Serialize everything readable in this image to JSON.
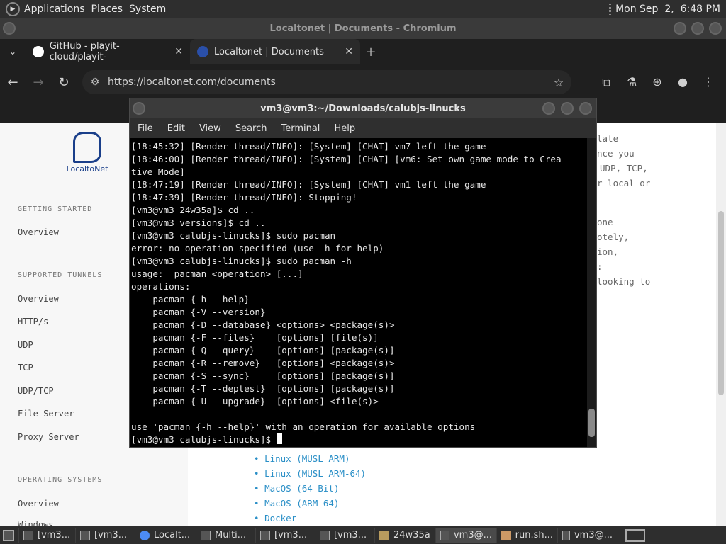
{
  "top_panel": {
    "menus": [
      "Applications",
      "Places",
      "System"
    ],
    "clock": "Mon Sep  2,  6:48 PM"
  },
  "browser": {
    "window_title": "Localtonet | Documents - Chromium",
    "tabs": [
      {
        "label": "GitHub - playit-cloud/playit-",
        "icon": "github-icon"
      },
      {
        "label": "Localtonet | Documents",
        "icon": "localtonet-icon"
      }
    ],
    "url": "https://localtonet.com/documents",
    "page": {
      "logo_text": "LocaltoNet",
      "sidebar": {
        "sections": [
          {
            "title": "GETTING STARTED",
            "items": [
              "Overview"
            ]
          },
          {
            "title": "SUPPORTED TUNNELS",
            "items": [
              "Overview",
              "HTTP/s",
              "UDP",
              "TCP",
              "UDP/TCP",
              "File Server",
              "Proxy Server"
            ]
          },
          {
            "title": "OPERATING SYSTEMS",
            "items": [
              "Overview",
              "Windows"
            ]
          }
        ]
      },
      "right_fragments": [
        "late",
        "nce you",
        "UDP, TCP,",
        "r local or",
        "one",
        "otely,",
        "ion,",
        ":",
        "looking to"
      ],
      "downloads": [
        "Linux (MUSL ARM)",
        "Linux (MUSL ARM-64)",
        "MacOS (64-Bit)",
        "MacOS (ARM-64)",
        "Docker"
      ]
    }
  },
  "terminal": {
    "title": "vm3@vm3:~/Downloads/calubjs-linucks",
    "menu": [
      "File",
      "Edit",
      "View",
      "Search",
      "Terminal",
      "Help"
    ],
    "lines": [
      "[18:45:32] [Render thread/INFO]: [System] [CHAT] vm7 left the game",
      "[18:46:00] [Render thread/INFO]: [System] [CHAT] [vm6: Set own game mode to Crea",
      "tive Mode]",
      "[18:47:19] [Render thread/INFO]: [System] [CHAT] vm1 left the game",
      "[18:47:39] [Render thread/INFO]: Stopping!",
      "[vm3@vm3 24w35a]$ cd ..",
      "[vm3@vm3 versions]$ cd ..",
      "[vm3@vm3 calubjs-linucks]$ sudo pacman",
      "error: no operation specified (use -h for help)",
      "[vm3@vm3 calubjs-linucks]$ sudo pacman -h",
      "usage:  pacman <operation> [...]",
      "operations:",
      "    pacman {-h --help}",
      "    pacman {-V --version}",
      "    pacman {-D --database} <options> <package(s)>",
      "    pacman {-F --files}    [options] [file(s)]",
      "    pacman {-Q --query}    [options] [package(s)]",
      "    pacman {-R --remove}   [options] <package(s)>",
      "    pacman {-S --sync}     [options] [package(s)]",
      "    pacman {-T --deptest}  [options] [package(s)]",
      "    pacman {-U --upgrade}  [options] <file(s)>",
      "",
      "use 'pacman {-h --help}' with an operation for available options"
    ],
    "prompt": "[vm3@vm3 calubjs-linucks]$ "
  },
  "taskbar": {
    "items": [
      {
        "label": "[vm3...",
        "icon": "terminal-icon"
      },
      {
        "label": "[vm3...",
        "icon": "terminal-icon"
      },
      {
        "label": "Localt...",
        "icon": "chromium-icon"
      },
      {
        "label": "Multi...",
        "icon": "window-icon"
      },
      {
        "label": "[vm3...",
        "icon": "terminal-icon"
      },
      {
        "label": "[vm3...",
        "icon": "terminal-icon"
      },
      {
        "label": "24w35a",
        "icon": "folder-icon"
      },
      {
        "label": "vm3@...",
        "icon": "terminal-icon"
      },
      {
        "label": "run.sh...",
        "icon": "text-editor-icon"
      },
      {
        "label": "vm3@...",
        "icon": "terminal-icon"
      }
    ]
  }
}
